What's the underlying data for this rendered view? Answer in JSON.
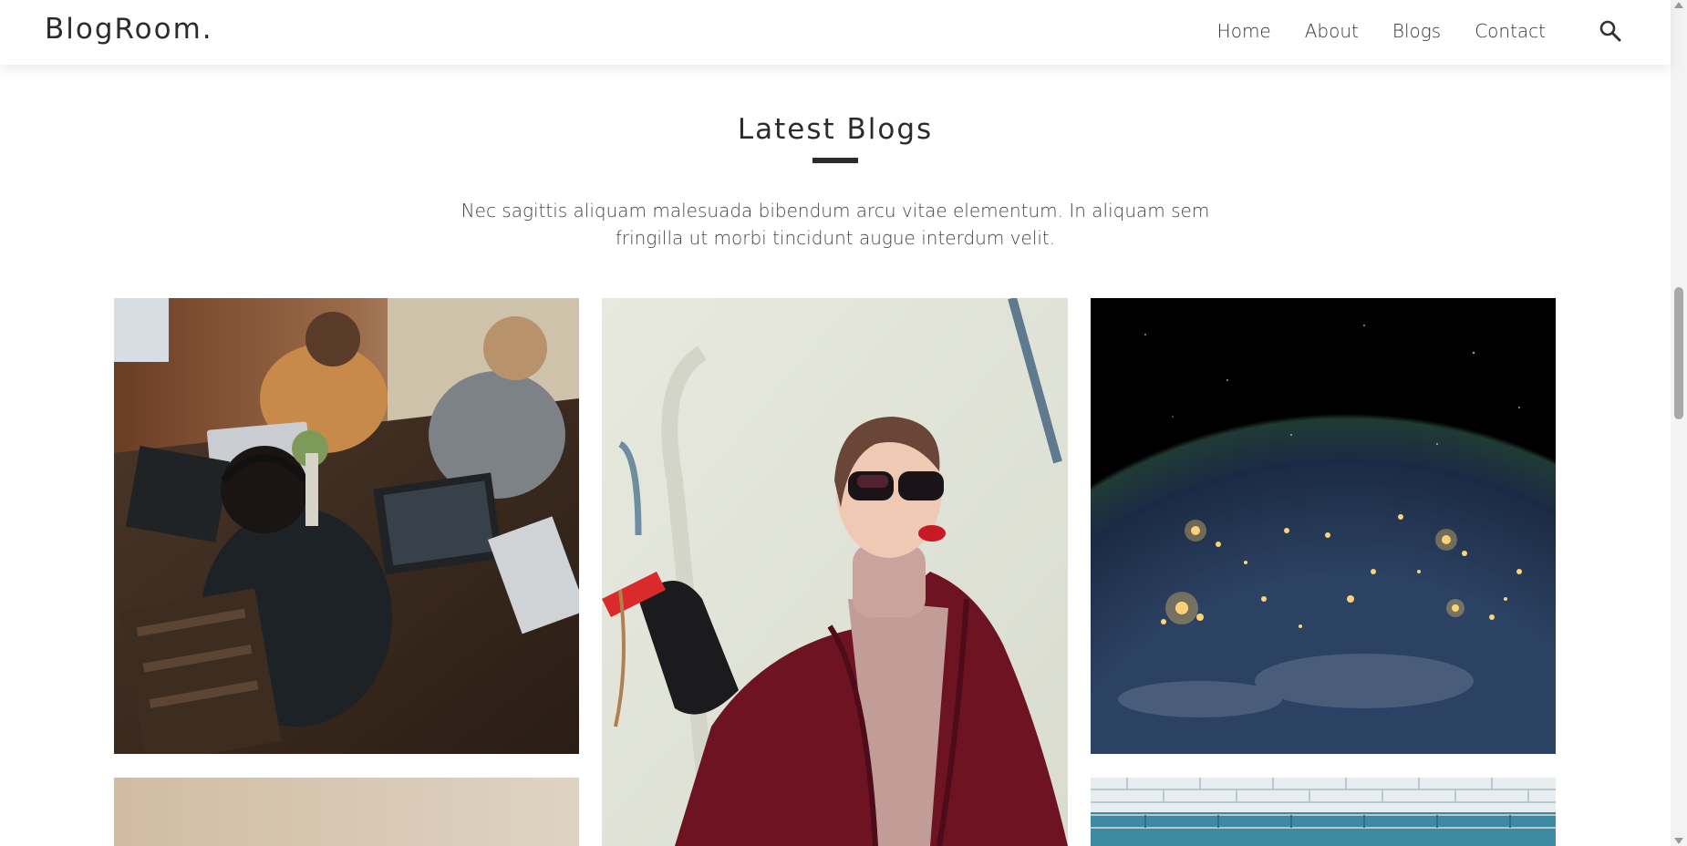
{
  "header": {
    "brand": "BlogRoom.",
    "nav": [
      {
        "label": "Home"
      },
      {
        "label": "About"
      },
      {
        "label": "Blogs"
      },
      {
        "label": "Contact"
      }
    ],
    "search_icon": "search-icon"
  },
  "section": {
    "title": "Latest Blogs",
    "description": "Nec sagittis aliquam malesuada bibendum arcu vitae elementum. In aliquam sem fringilla ut morbi tincidunt augue interdum velit."
  },
  "cards": [
    {
      "image": "team-working-on-laptops-photo"
    },
    {
      "image": "woman-in-red-coat-with-sunglasses-photo"
    },
    {
      "image": "earth-night-lights-from-space-photo"
    },
    {
      "image": "beige-gradient-photo"
    },
    {
      "image": "blue-painted-brick-wall-photo"
    }
  ],
  "colors": {
    "text": "#2b2b2b",
    "accent_bar": "#2b2b2b",
    "background": "#ffffff"
  }
}
